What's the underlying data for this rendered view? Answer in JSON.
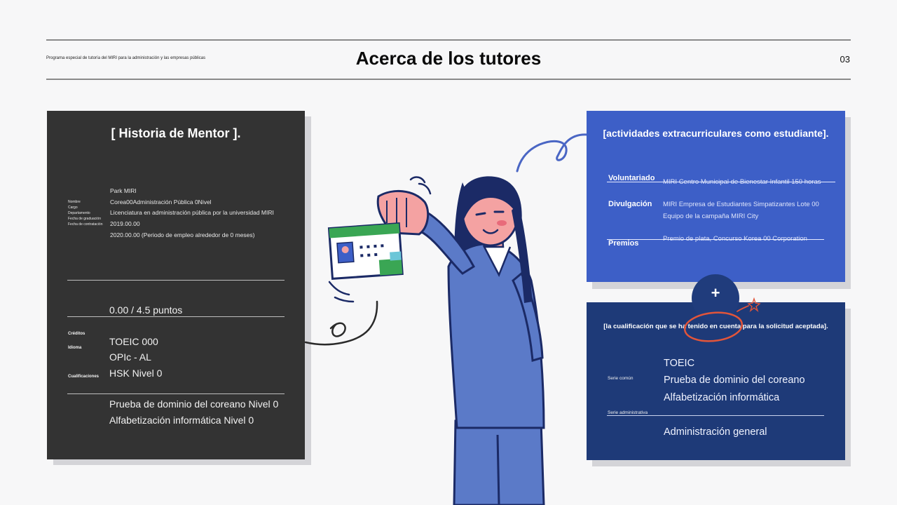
{
  "header": {
    "subtitle": "Programa especial de tutoría del MIRI para la administración y las empresas públicas",
    "title": "Acerca de los tutores",
    "page_number": "03"
  },
  "mentor": {
    "title": "[ Historia de Mentor ].",
    "labels": [
      "Nombre",
      "Cargo",
      "Departamento",
      "Fecha de graduación",
      "Fecha de contratación"
    ],
    "info": [
      "Park MIRI",
      "Corea00Administración Pública 0Nivel",
      "Licenciatura en administración pública por la universidad MIRI",
      "2019.00.00",
      "2020.00.00 (Periodo de empleo alrededor de 0 meses)"
    ],
    "score": "0.00 / 4.5 puntos",
    "section_labels": {
      "credits": "Créditos",
      "language": "Idioma",
      "qualifications": "Cualificaciones"
    },
    "languages": [
      "TOEIC 000",
      "OPIc - AL",
      "HSK Nivel 0"
    ],
    "certificates": [
      "Prueba de dominio del coreano Nivel 0",
      "Alfabetización informática Nivel 0"
    ]
  },
  "activities": {
    "title": "[actividades extracurriculares como estudiante].",
    "volunteer_label": "Voluntariado",
    "volunteer_value": "MIRI Centro Municipal de Bienestar Infantil 150 horas",
    "outreach_label": "Divulgación",
    "outreach_value_1": "MIRI Empresa de Estudiantes Simpatizantes Lote 00",
    "outreach_value_2": "Equipo de la campaña MIRI City",
    "awards_label": "Premios",
    "awards_value": "Premio de plata, Concurso Korea 00 Corporation"
  },
  "plus_symbol": "+",
  "qualification": {
    "title": "[la cualificación que se ha tenido en cuenta para la solicitud aceptada].",
    "common_label": "Serie común",
    "common_items": [
      "TOEIC",
      "Prueba de dominio del coreano",
      "Alfabetización informática"
    ],
    "admin_label": "Serie administrativa",
    "admin_items": [
      "Administración general"
    ]
  },
  "colors": {
    "dark_card": "#333333",
    "blue_card": "#3d5fc7",
    "navy_card": "#1e3a78",
    "highlight": "#e2553a",
    "jacket": "#5b7ac8"
  },
  "icons": [
    "plus-icon",
    "star-icon"
  ]
}
